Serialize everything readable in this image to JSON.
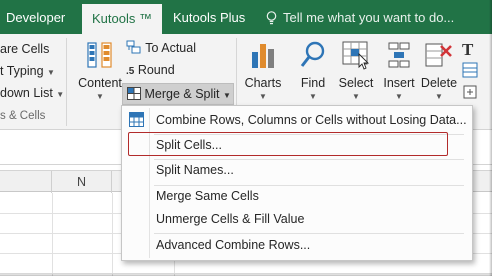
{
  "tabs": {
    "developer": "Developer",
    "kutools": "Kutools ™",
    "kutools_plus": "Kutools Plus",
    "tell_me": "Tell me what you want to do..."
  },
  "ribbon": {
    "left_group": {
      "item1": "are Cells",
      "item2": "t Typing",
      "item3": "down List",
      "label": "s & Cells"
    },
    "content": "Content",
    "to_actual": "To Actual",
    "round": "Round",
    "merge_split": "Merge & Split",
    "charts": "Charts",
    "find": "Find",
    "select": "Select",
    "insert": "Insert",
    "delete": "Delete"
  },
  "columns": [
    "N",
    "O"
  ],
  "menu": {
    "items": [
      "Combine Rows, Columns or Cells without Losing Data...",
      "Split Cells...",
      "Split Names...",
      "Merge Same Cells",
      "Unmerge Cells & Fill Value",
      "Advanced Combine Rows..."
    ],
    "selected": "Split Cells..."
  },
  "colors": {
    "ribbon_green": "#217346",
    "highlight_border": "#b22b2b",
    "icon_blue": "#2e75b6"
  }
}
